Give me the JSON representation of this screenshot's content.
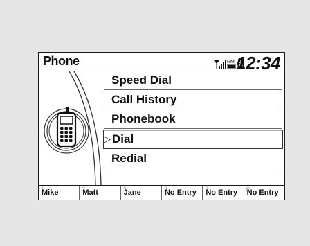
{
  "header": {
    "title": "Phone",
    "time": "12:34",
    "status_icons": [
      "signal-strength-icon",
      "roaming-icon",
      "battery-icon",
      "bluetooth-icon"
    ],
    "roaming_text": "RM"
  },
  "menu": {
    "items": [
      {
        "label": "Speed Dial",
        "selected": false
      },
      {
        "label": "Call History",
        "selected": false
      },
      {
        "label": "Phonebook",
        "selected": false
      },
      {
        "label": "Dial",
        "selected": true
      },
      {
        "label": "Redial",
        "selected": false
      }
    ]
  },
  "quick_dial": [
    {
      "num": "1",
      "name": "Mike"
    },
    {
      "num": "2",
      "name": "Matt"
    },
    {
      "num": "3",
      "name": "Jane"
    },
    {
      "num": "4",
      "name": "No Entry"
    },
    {
      "num": "5",
      "name": "No Entry"
    },
    {
      "num": "6",
      "name": "No Entry"
    }
  ],
  "colors": {
    "frame": "#1a1a1a",
    "screen_bg": "#ffffff",
    "page_bg": "#e6e6e6"
  }
}
